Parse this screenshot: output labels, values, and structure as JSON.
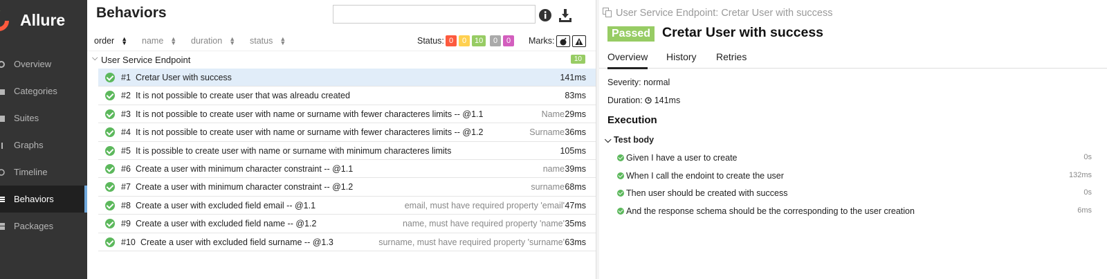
{
  "sidebar": {
    "brand": "Allure",
    "items": [
      {
        "label": "Overview",
        "icon": "overview-icon"
      },
      {
        "label": "Categories",
        "icon": "categories-icon"
      },
      {
        "label": "Suites",
        "icon": "suites-icon"
      },
      {
        "label": "Graphs",
        "icon": "graphs-icon"
      },
      {
        "label": "Timeline",
        "icon": "timeline-icon"
      },
      {
        "label": "Behaviors",
        "icon": "behaviors-icon",
        "active": true
      },
      {
        "label": "Packages",
        "icon": "packages-icon"
      }
    ]
  },
  "behaviors": {
    "title": "Behaviors",
    "search": {
      "value": "",
      "placeholder": ""
    },
    "sort": {
      "order": "order",
      "name": "name",
      "duration": "duration",
      "status": "status"
    },
    "status_label": "Status:",
    "status_counts": [
      {
        "value": "0",
        "color": "#fd5a3e"
      },
      {
        "value": "0",
        "color": "#ffd050"
      },
      {
        "value": "10",
        "color": "#97cc64"
      },
      {
        "value": "0",
        "color": "#aaaaaa"
      },
      {
        "value": "0",
        "color": "#d35ebe"
      }
    ],
    "marks_label": "Marks:",
    "group": {
      "name": "User Service Endpoint",
      "count": "10"
    },
    "rows": [
      {
        "num": "#1",
        "name": "Cretar User with success",
        "param": "",
        "duration": "141ms",
        "selected": true
      },
      {
        "num": "#2",
        "name": "It is not possible to create user that was alreadu created",
        "param": "",
        "duration": "83ms"
      },
      {
        "num": "#3",
        "name": "It is not possible to create user with name or surname with fewer characteres limits -- @1.1",
        "param": "Name",
        "duration": "29ms"
      },
      {
        "num": "#4",
        "name": "It is not possible to create user with name or surname with fewer characteres limits -- @1.2",
        "param": "Surname",
        "duration": "36ms"
      },
      {
        "num": "#5",
        "name": "It is possible to create user with name or surname with minimum characteres limits",
        "param": "",
        "duration": "105ms"
      },
      {
        "num": "#6",
        "name": "Create a user with minimum character constraint -- @1.1",
        "param": "name",
        "duration": "39ms"
      },
      {
        "num": "#7",
        "name": "Create a user with minimum character constraint -- @1.2",
        "param": "surname",
        "duration": "68ms"
      },
      {
        "num": "#8",
        "name": "Create a user with excluded field email -- @1.1",
        "param": "email, must have required property 'email'",
        "duration": "47ms"
      },
      {
        "num": "#9",
        "name": "Create a user with excluded field name -- @1.2",
        "param": "name, must have required property 'name'",
        "duration": "35ms"
      },
      {
        "num": "#10",
        "name": "Create a user with excluded field surname -- @1.3",
        "param": "surname, must have required property 'surname'",
        "duration": "63ms"
      }
    ]
  },
  "detail": {
    "breadcrumb": "User Service Endpoint: Cretar User with success",
    "status": "Passed",
    "title": "Cretar User with success",
    "tabs": [
      "Overview",
      "History",
      "Retries"
    ],
    "severity": "Severity: normal",
    "duration_label": "Duration:",
    "duration_value": "141ms",
    "execution_title": "Execution",
    "test_body_label": "Test body",
    "steps": [
      {
        "label": "Given I have a user to create",
        "duration": "0s"
      },
      {
        "label": "When I call the endoint to create the user",
        "duration": "132ms"
      },
      {
        "label": "Then user should be created with success",
        "duration": "0s"
      },
      {
        "label": "And the response schema should be the corresponding to the user creation",
        "duration": "6ms"
      }
    ]
  },
  "colors": {
    "sidebar_bg": "#343434",
    "passed": "#97cc64",
    "selected_row": "#e1edf9"
  }
}
